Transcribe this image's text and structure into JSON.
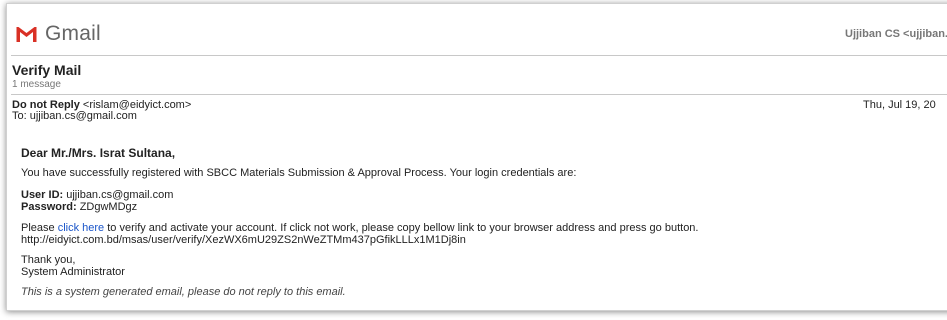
{
  "header": {
    "logo_text": "Gmail",
    "account": "Ujjiban CS <ujjiban.cs@"
  },
  "thread": {
    "subject": "Verify Mail",
    "message_count": "1 message"
  },
  "message": {
    "from_name": "Do not Reply",
    "from_email": "<rislam@eidyict.com>",
    "to": "To: ujjiban.cs@gmail.com",
    "date": "Thu, Jul 19, 20",
    "greeting": "Dear Mr./Mrs. Israt Sultana,",
    "intro": "You have successfully registered with SBCC Materials Submission & Approval Process. Your login credentials are:",
    "user_id_label": "User ID:",
    "user_id_value": "ujjiban.cs@gmail.com",
    "password_label": "Password:",
    "password_value": "ZDgwMDgz",
    "please": "Please",
    "click_here": "click here",
    "verify_text": "to verify and activate your account. If click not work, please copy bellow link to your browser address and press go button.",
    "verify_url": "http://eidyict.com.bd/msas/user/verify/XezWX6mU29ZS2nWeZTMm437pGfikLLLx1M1Dj8in",
    "thanks": "Thank you,",
    "signature": "System Administrator",
    "footer_note": "This is a system generated email, please do not reply to this email."
  },
  "colors": {
    "gmail_red": "#d93025",
    "link_blue": "#1a55c9"
  },
  "icons": {
    "logo": "gmail-m-icon"
  }
}
